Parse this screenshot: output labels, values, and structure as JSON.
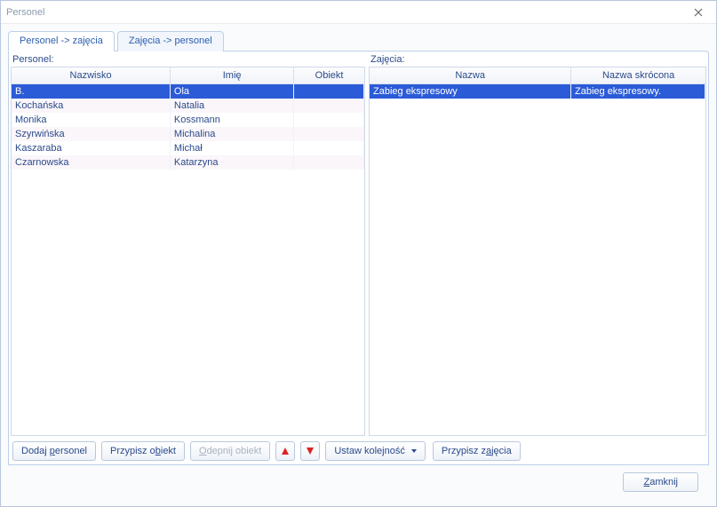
{
  "window": {
    "title": "Personel"
  },
  "tabs": [
    {
      "label": "Personel -> zajęcia",
      "active": true
    },
    {
      "label": "Zajęcia -> personel",
      "active": false
    }
  ],
  "left_pane": {
    "label": "Personel:",
    "columns": [
      "Nazwisko",
      "Imię",
      "Obiekt"
    ],
    "rows": [
      {
        "nazwisko": "B.",
        "imie": "Ola",
        "obiekt": "",
        "selected": true
      },
      {
        "nazwisko": "Kochańska",
        "imie": "Natalia",
        "obiekt": "",
        "selected": false
      },
      {
        "nazwisko": "Monika",
        "imie": "Kossmann",
        "obiekt": "",
        "selected": false
      },
      {
        "nazwisko": "Szyrwińska",
        "imie": "Michalina",
        "obiekt": "",
        "selected": false
      },
      {
        "nazwisko": "Kaszaraba",
        "imie": "Michał",
        "obiekt": "",
        "selected": false
      },
      {
        "nazwisko": "Czarnowska",
        "imie": "Katarzyna",
        "obiekt": "",
        "selected": false
      }
    ]
  },
  "right_pane": {
    "label": "Zajęcia:",
    "columns": [
      "Nazwa",
      "Nazwa skrócona"
    ],
    "rows": [
      {
        "nazwa": "Zabieg ekspresowy",
        "skrot": "Zabieg ekspresowy.",
        "selected": true
      }
    ]
  },
  "buttons": {
    "dodaj_personel": "Dodaj personel",
    "przypisz_obiekt": "Przypisz obiekt",
    "odepnij_obiekt": "Odepnij obiekt",
    "ustaw_kolejnosc": "Ustaw kolejność",
    "przypisz_zajecia": "Przypisz zajęcia",
    "zamknij": "Zamknij"
  }
}
